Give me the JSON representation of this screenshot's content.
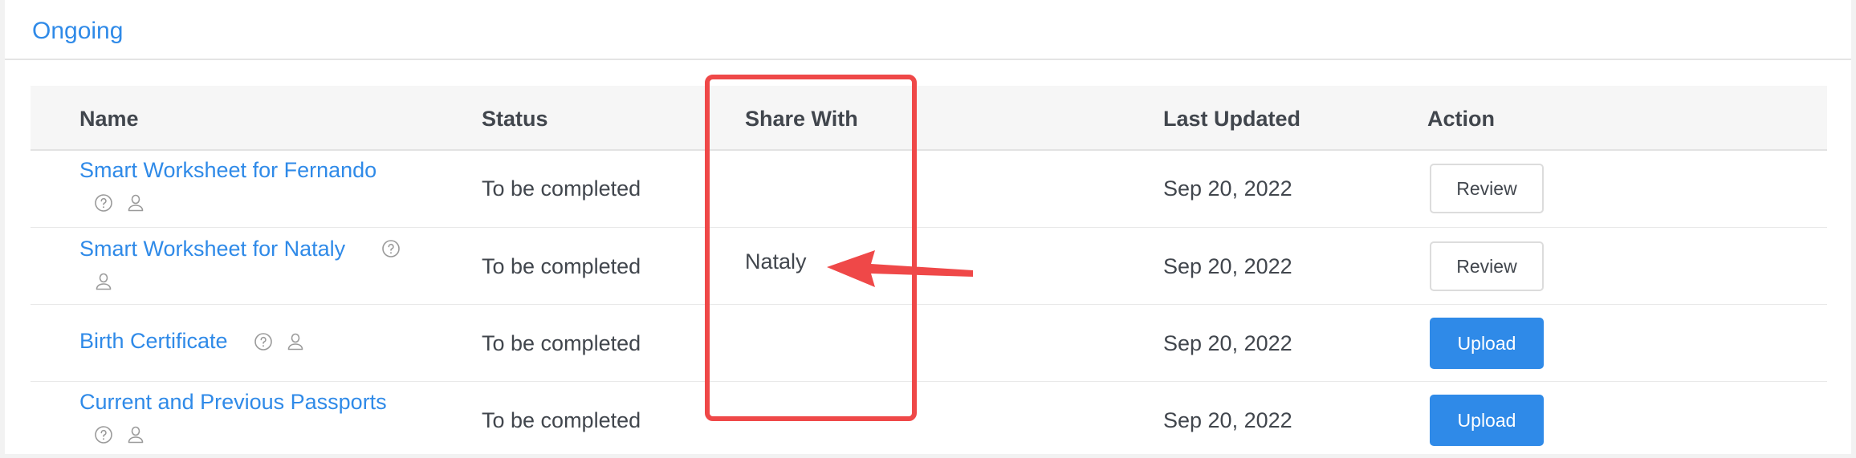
{
  "section": {
    "title": "Ongoing"
  },
  "table": {
    "columns": {
      "name": "Name",
      "status": "Status",
      "share_with": "Share With",
      "last_updated": "Last Updated",
      "action": "Action"
    },
    "rows": [
      {
        "name": "Smart Worksheet for Fernando",
        "status": "To be completed",
        "share_with": "",
        "last_updated": "Sep 20, 2022",
        "action": "Review"
      },
      {
        "name": "Smart Worksheet for Nataly",
        "status": "To be completed",
        "share_with": "Nataly",
        "last_updated": "Sep 20, 2022",
        "action": "Review"
      },
      {
        "name": "Birth Certificate",
        "status": "To be completed",
        "share_with": "",
        "last_updated": "Sep 20, 2022",
        "action": "Upload"
      },
      {
        "name": "Current and Previous Passports",
        "status": "To be completed",
        "share_with": "",
        "last_updated": "Sep 20, 2022",
        "action": "Upload"
      }
    ]
  },
  "icons": {
    "help": "help-circle-icon",
    "person": "person-icon"
  },
  "colors": {
    "link": "#2f8ae8",
    "primary_button": "#2f8ae8",
    "annotation": "#ef4848"
  }
}
